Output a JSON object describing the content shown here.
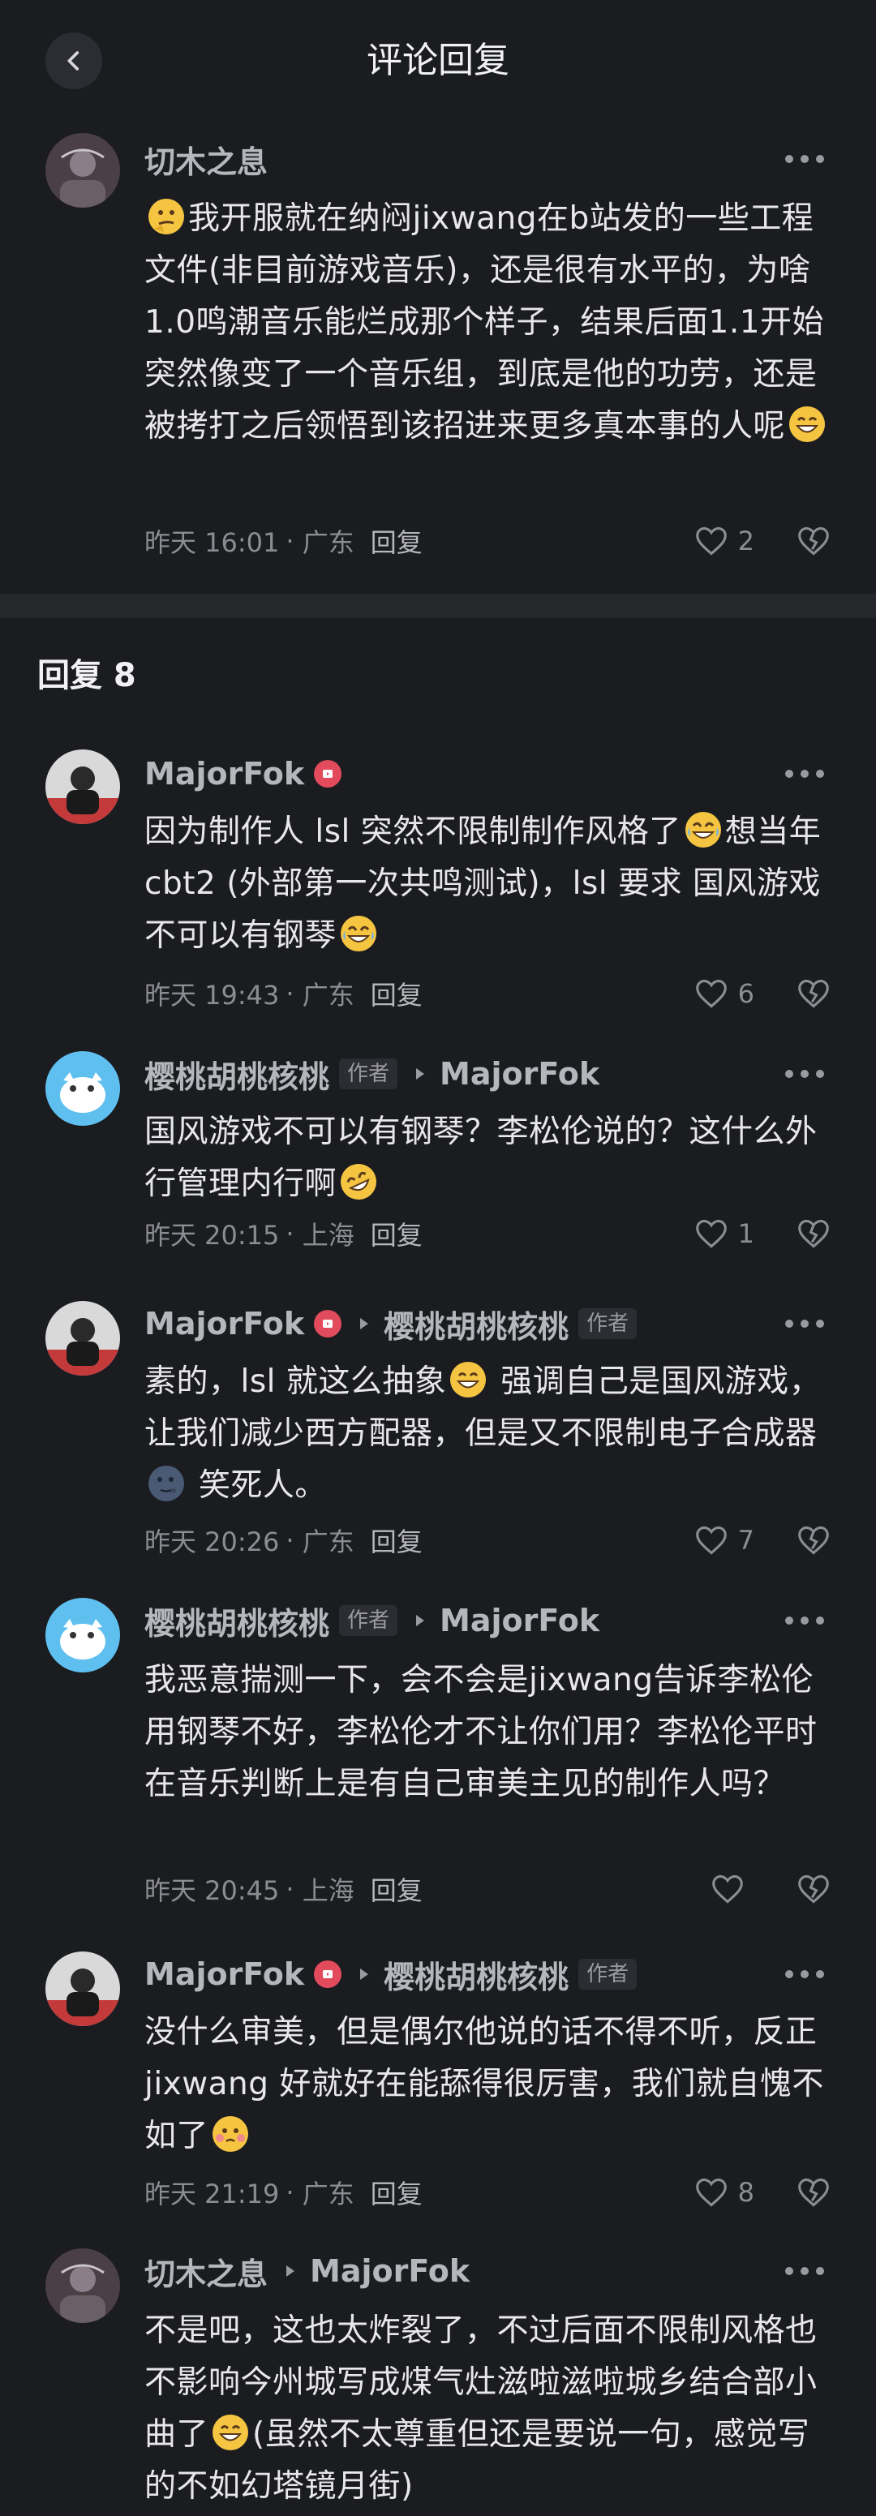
{
  "header": {
    "title": "评论回复"
  },
  "main_comment": {
    "user": "切木之息",
    "text_parts": [
      "",
      "我开服就在纳闷jixwang在b站发的一些工程文件(非目前游戏音乐)，还是很有水平的，为啥1.0鸣潮音乐能烂成那个样子，结果后面1.1开始突然像变了一个音乐组，到底是他的功劳，还是被拷打之后领悟到该招进来更多真本事的人呢",
      ""
    ],
    "time": "昨天 16:01",
    "location": "广东",
    "reply_label": "回复",
    "likes": "2"
  },
  "replies_header": "回复 8",
  "common": {
    "author_tag": "作者",
    "reply_label": "回复",
    "dot": "·"
  },
  "replies": [
    {
      "user": "MajorFok",
      "text": "因为制作人 lsl 突然不限制制作风格了",
      "text2": "想当年 cbt2 (外部第一次共鸣测试)，lsl 要求 国风游戏不可以有钢琴",
      "time": "昨天 19:43",
      "location": "广东",
      "likes": "6"
    },
    {
      "user": "樱桃胡桃核桃",
      "target": "MajorFok",
      "text": "国风游戏不可以有钢琴？李松伦说的？这什么外行管理内行啊",
      "time": "昨天 20:15",
      "location": "上海",
      "likes": "1"
    },
    {
      "user": "MajorFok",
      "target": "樱桃胡桃核桃",
      "text": "素的，lsl 就这么抽象",
      "text2": " 强调自己是国风游戏，让我们减少西方配器，但是又不限制电子合成器",
      "text3": " 笑死人。",
      "time": "昨天 20:26",
      "location": "广东",
      "likes": "7"
    },
    {
      "user": "樱桃胡桃核桃",
      "target": "MajorFok",
      "text": "我恶意揣测一下，会不会是jixwang告诉李松伦用钢琴不好，李松伦才不让你们用？李松伦平时在音乐判断上是有自己审美主见的制作人吗？",
      "time": "昨天 20:45",
      "location": "上海",
      "likes": ""
    },
    {
      "user": "MajorFok",
      "target": "樱桃胡桃核桃",
      "text": "没什么审美，但是偶尔他说的话不得不听，反正 jixwang 好就好在能舔得很厉害，我们就自愧不如了",
      "time": "昨天 21:19",
      "location": "广东",
      "likes": "8"
    },
    {
      "user": "切木之息",
      "target": "MajorFok",
      "text": "不是吧，这也太炸裂了，不过后面不限制风格也不影响今州城写成煤气灶滋啦滋啦城乡结合部小曲了",
      "text2": "(虽然不太尊重但还是要说一句，感觉写的不如幻塔镜月街)"
    }
  ],
  "colors": {
    "bg": "#1b1c20",
    "divider": "#26272b",
    "badge": "#e24b5b",
    "meta": "#8c8d92"
  }
}
